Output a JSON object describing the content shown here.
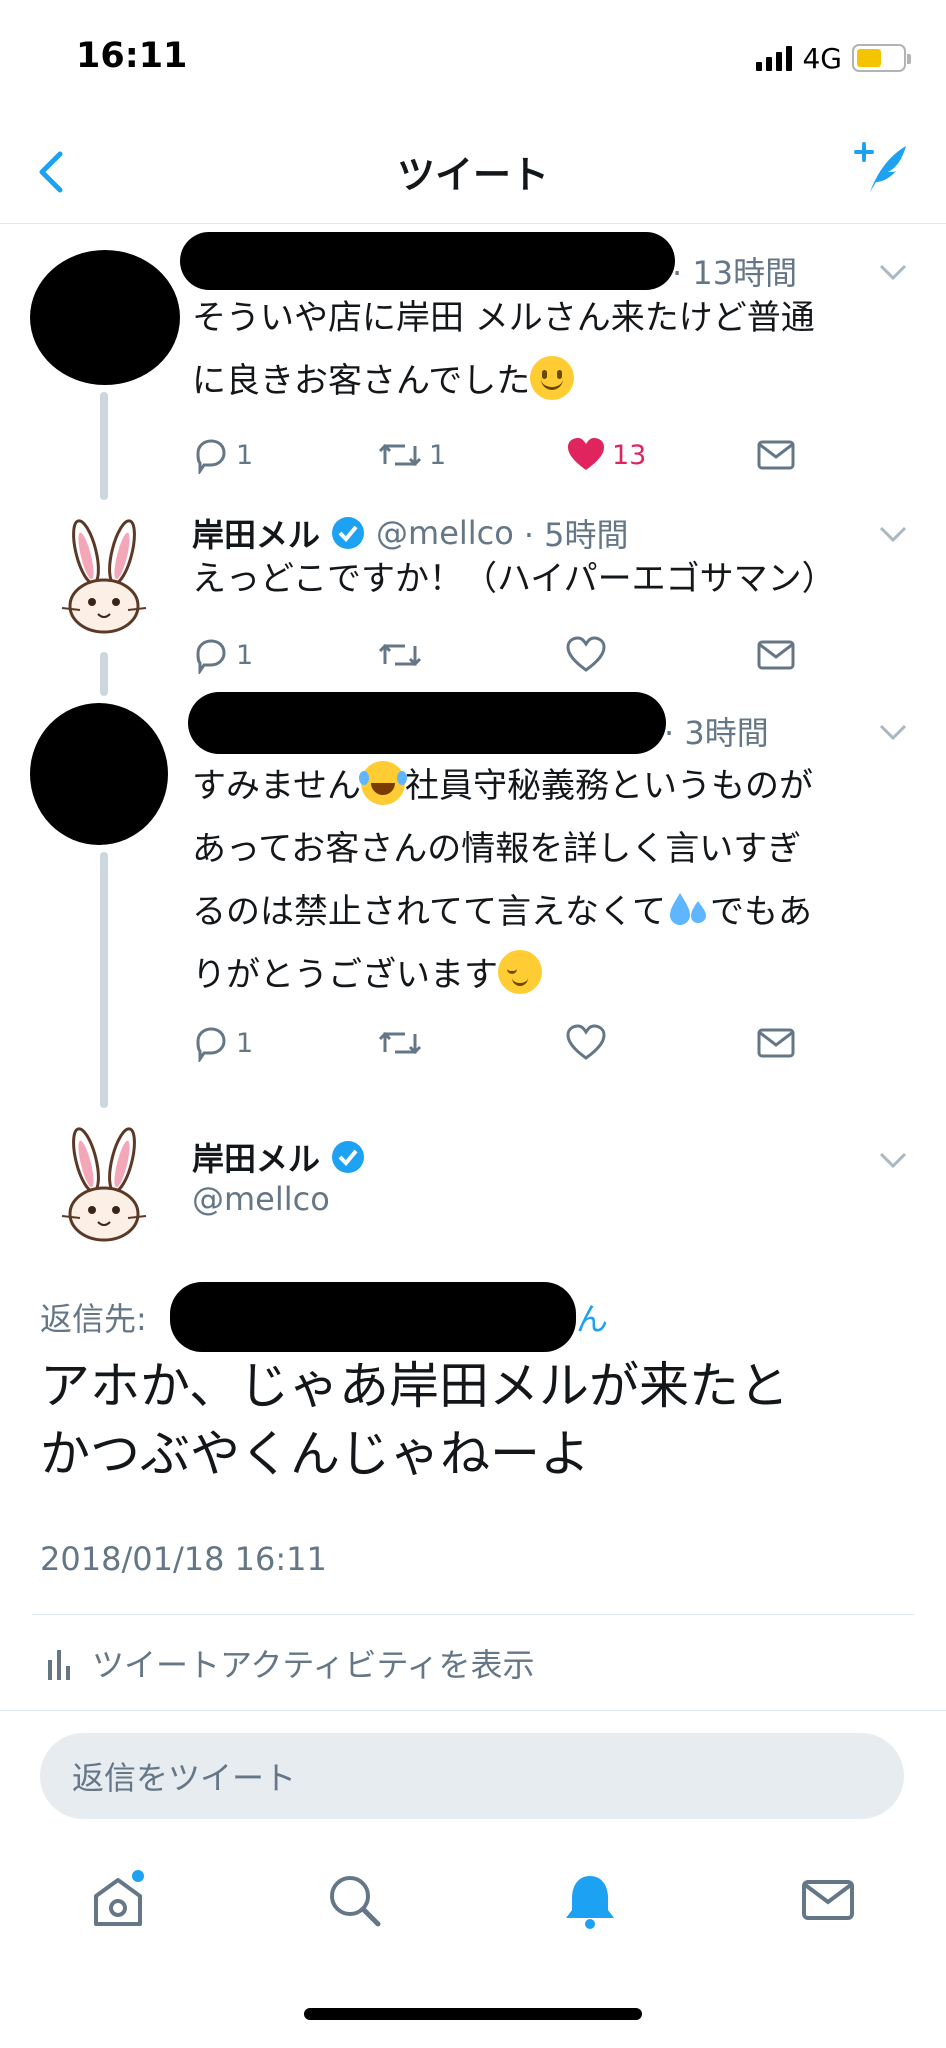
{
  "status": {
    "time": "16:11",
    "network": "4G",
    "battery_color": "#f5c400"
  },
  "nav": {
    "title": "ツイート"
  },
  "tweets": [
    {
      "name": "",
      "handle": "",
      "time": "· 13時間",
      "lines": [
        "そういや店に岸田 メルさん来たけど普通",
        "に良きお客さんでした"
      ],
      "replies": "1",
      "retweets": "1",
      "likes": "13",
      "liked": true
    },
    {
      "name": "岸田メル",
      "verified": true,
      "handle": "@mellco",
      "time": "· 5時間",
      "lines": [
        "えっどこですか！（ハイパーエゴサマン）"
      ],
      "replies": "1",
      "retweets": "",
      "likes": ""
    },
    {
      "name": "",
      "handle": "",
      "time": "· 3時間",
      "lines": [
        "すみません",
        "社員守秘義務というものが",
        "あってお客さんの情報を詳しく言いすぎ",
        "るのは禁止されてて言えなくて",
        "でもあ",
        "りがとうございます"
      ],
      "replies": "1",
      "retweets": "",
      "likes": ""
    }
  ],
  "main_tweet": {
    "name": "岸田メル",
    "verified": true,
    "handle": "@mellco",
    "reply_to_label": "返信先:",
    "reply_to_tail": "ん",
    "body_line1": "アホか、じゃあ岸田メルが来たと",
    "body_line2": "かつぶやくんじゃねーよ",
    "timestamp": "2018/01/18 16:11",
    "activity_label": "ツイートアクティビティを表示"
  },
  "composer": {
    "placeholder": "返信をツイート"
  },
  "tabbar": {
    "items": [
      "home-icon",
      "search-icon",
      "notifications-icon",
      "messages-icon"
    ],
    "active": "notifications-icon"
  },
  "colors": {
    "accent": "#1da1f2",
    "like": "#e0245e",
    "muted": "#657786",
    "verified": "#1da1f2"
  }
}
